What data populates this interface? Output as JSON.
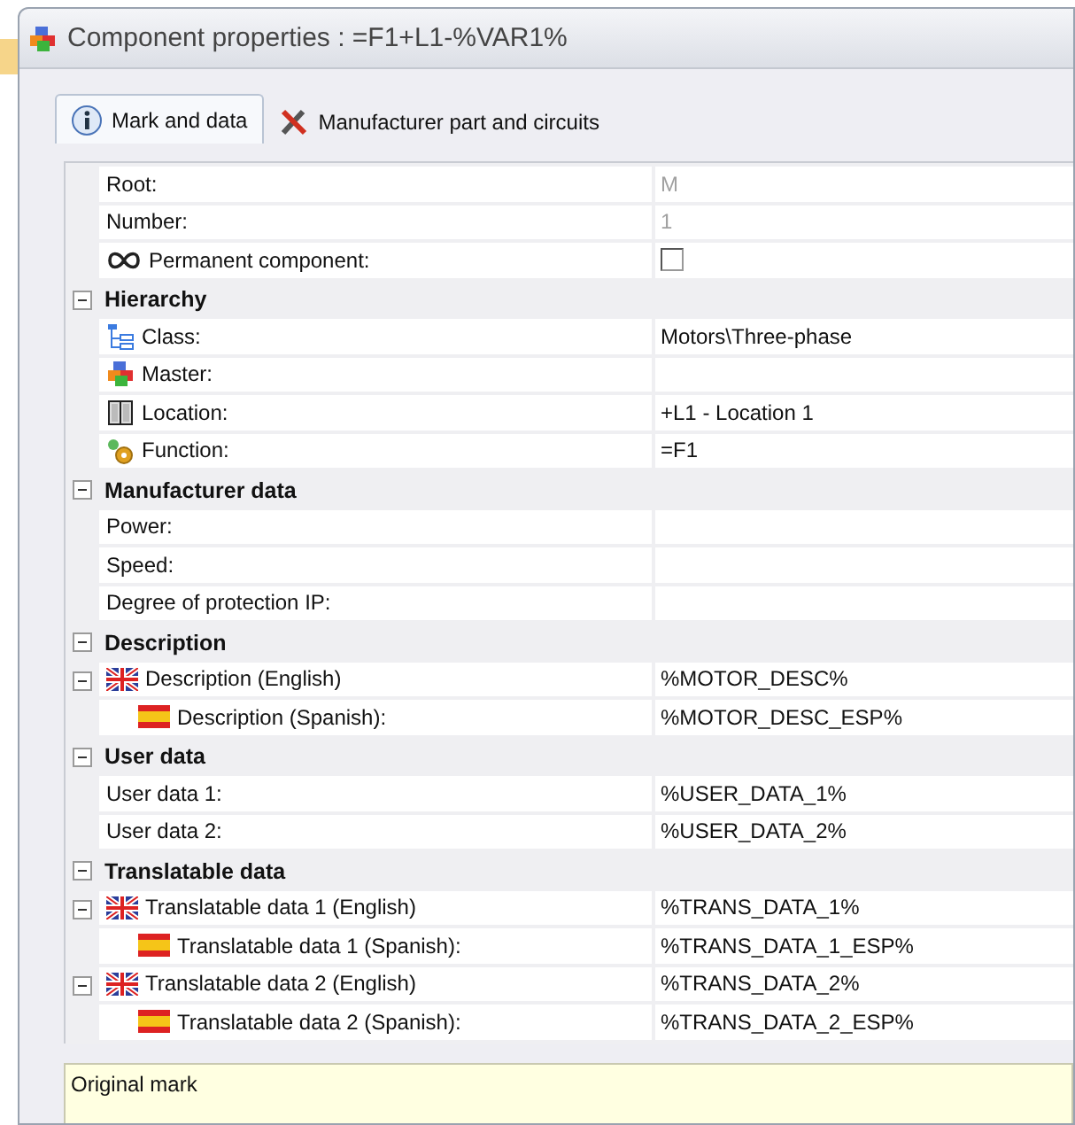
{
  "window": {
    "title": "Component properties : =F1+L1-%VAR1%"
  },
  "tabs": [
    {
      "label": "Mark and data",
      "selected": true
    },
    {
      "label": "Manufacturer part and circuits",
      "selected": false
    }
  ],
  "rows": [
    {
      "kind": "text",
      "label": "Root:",
      "value": "M",
      "disabled": true
    },
    {
      "kind": "text",
      "label": "Number:",
      "value": "1",
      "disabled": true
    },
    {
      "kind": "checkbox",
      "label": "Permanent component:",
      "checked": false
    }
  ],
  "sections": [
    {
      "title": "Hierarchy",
      "expanded": true,
      "rows": [
        {
          "kind": "text",
          "label": "Class:",
          "value": "Motors\\Three-phase"
        },
        {
          "kind": "text",
          "label": "Master:"
        },
        {
          "kind": "text",
          "label": "Location:",
          "value": "+L1 - Location 1"
        },
        {
          "kind": "text",
          "label": "Function:",
          "value": "=F1"
        }
      ]
    },
    {
      "title": "Manufacturer data",
      "expanded": true,
      "rows": [
        {
          "kind": "text",
          "label": "Power:"
        },
        {
          "kind": "text",
          "label": "Speed:"
        },
        {
          "kind": "text",
          "label": "Degree of protection IP:"
        }
      ]
    },
    {
      "title": "Description",
      "expanded": true,
      "rows": [
        {
          "kind": "text",
          "label": "Description (English)",
          "value": "%MOTOR_DESC%",
          "expanded": true,
          "children": [
            {
              "kind": "text",
              "label": "Description (Spanish):",
              "value": "%MOTOR_DESC_ESP%"
            }
          ]
        }
      ]
    },
    {
      "title": "User data",
      "expanded": true,
      "rows": [
        {
          "kind": "text",
          "label": "User data 1:",
          "value": "%USER_DATA_1%"
        },
        {
          "kind": "text",
          "label": "User data 2:",
          "value": "%USER_DATA_2%"
        }
      ]
    },
    {
      "title": "Translatable data",
      "expanded": true,
      "rows": [
        {
          "kind": "text",
          "label": "Translatable data 1 (English)",
          "value": "%TRANS_DATA_1%",
          "expanded": true,
          "children": [
            {
              "kind": "text",
              "label": "Translatable data 1 (Spanish):",
              "value": "%TRANS_DATA_1_ESP%"
            }
          ]
        },
        {
          "kind": "text",
          "label": "Translatable data 2 (English)",
          "value": "%TRANS_DATA_2%",
          "expanded": true,
          "children": [
            {
              "kind": "text",
              "label": "Translatable data 2 (Spanish):",
              "value": "%TRANS_DATA_2_ESP%"
            }
          ]
        }
      ]
    }
  ],
  "description_panel": {
    "text": "Original mark"
  }
}
